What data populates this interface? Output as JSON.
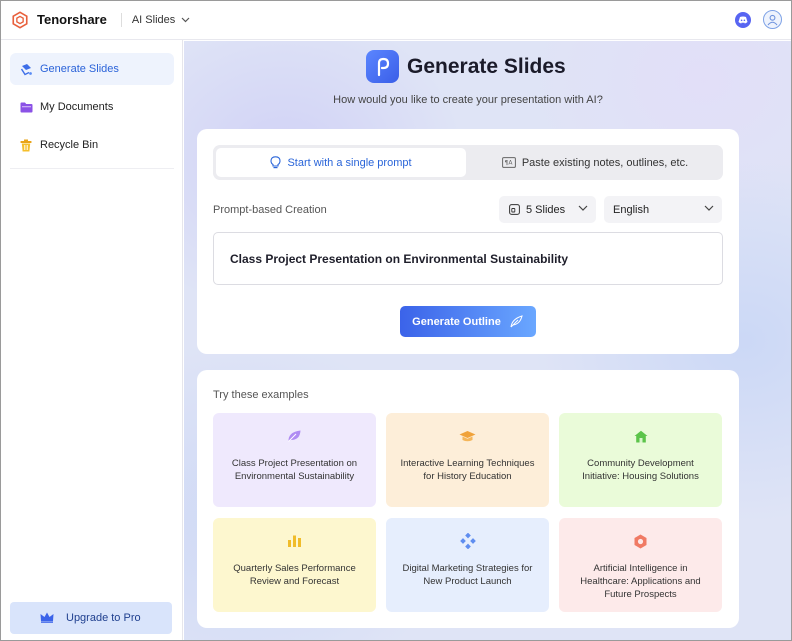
{
  "topbar": {
    "brand": "Tenorshare",
    "app_switch": "AI Slides",
    "icons": [
      "discord-icon",
      "user-avatar-icon"
    ]
  },
  "sidebar": {
    "items": [
      {
        "label": "Generate Slides",
        "icon": "generate-slides-icon",
        "active": true
      },
      {
        "label": "My Documents",
        "icon": "folder-icon",
        "active": false
      },
      {
        "label": "Recycle Bin",
        "icon": "trash-icon",
        "active": false
      }
    ],
    "upgrade_label": "Upgrade to Pro"
  },
  "main": {
    "title": "Generate Slides",
    "subtitle": "How would you like to create your presentation with AI?",
    "tabs": [
      {
        "label": "Start with a single prompt",
        "active": true
      },
      {
        "label": "Paste existing notes, outlines, etc.",
        "active": false
      }
    ],
    "section_label": "Prompt-based Creation",
    "slides_select": "5 Slides",
    "language_select": "English",
    "prompt_value": "Class Project Presentation on Environmental Sustainability",
    "generate_button": "Generate Outline",
    "examples_label": "Try these examples",
    "examples": [
      {
        "text": "Class Project Presentation on Environmental Sustainability",
        "icon": "leaf-icon",
        "color": "#9b6cf0"
      },
      {
        "text": "Interactive Learning Techniques for History Education",
        "icon": "graduation-cap-icon",
        "color": "#f0a23a"
      },
      {
        "text": "Community Development Initiative: Housing Solutions",
        "icon": "house-icon",
        "color": "#5cc44a"
      },
      {
        "text": "Quarterly Sales Performance Review and Forecast",
        "icon": "bar-chart-icon",
        "color": "#f0bc2a"
      },
      {
        "text": "Digital Marketing Strategies for New Product Launch",
        "icon": "diamond-grid-icon",
        "color": "#5f8df0"
      },
      {
        "text": "Artificial Intelligence in Healthcare: Applications and Future Prospects",
        "icon": "ai-hex-icon",
        "color": "#f07a64"
      }
    ]
  },
  "colors": {
    "accent": "#2b63d9",
    "button_start": "#3b63e9",
    "button_end": "#6aa7ff"
  }
}
